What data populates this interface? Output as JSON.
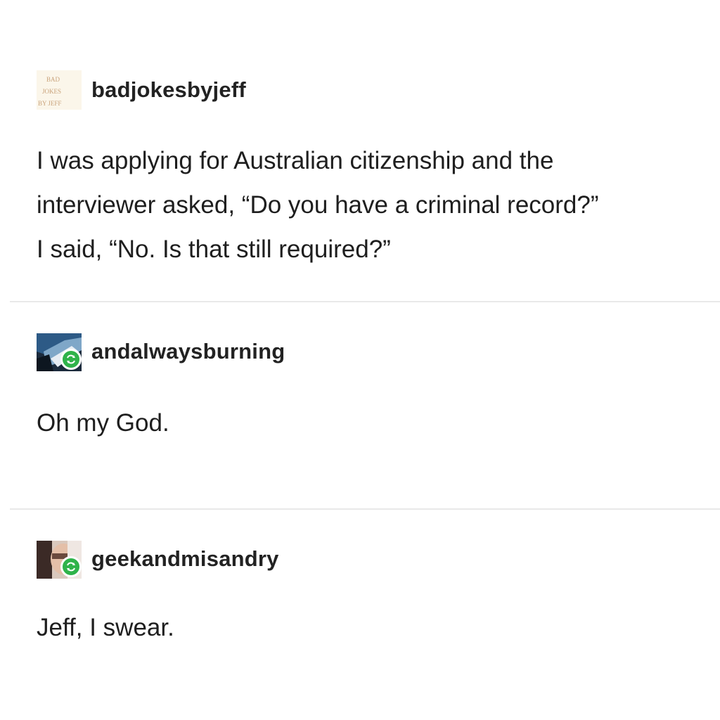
{
  "posts": [
    {
      "username": "badjokesbyjeff",
      "avatar_icon": "book-cover-avatar-icon",
      "avatar_text": [
        "BAD",
        "JOKES",
        "BY JEFF"
      ],
      "lines": [
        "I was applying for Australian citizenship and the",
        "interviewer asked, “Do you have a criminal record?”",
        "I said, “No. Is that still required?”"
      ]
    },
    {
      "username": "andalwaysburning",
      "avatar_icon": "anime-character-avatar-icon",
      "badge_icon": "reblog-icon",
      "lines": [
        "Oh my God."
      ]
    },
    {
      "username": "geekandmisandry",
      "avatar_icon": "person-photo-avatar-icon",
      "badge_icon": "reblog-icon",
      "lines": [
        "Jeff, I swear."
      ]
    }
  ],
  "colors": {
    "reblog_badge": "#2fb34a",
    "divider": "#e9e9e9",
    "text": "#1e1e1e"
  }
}
